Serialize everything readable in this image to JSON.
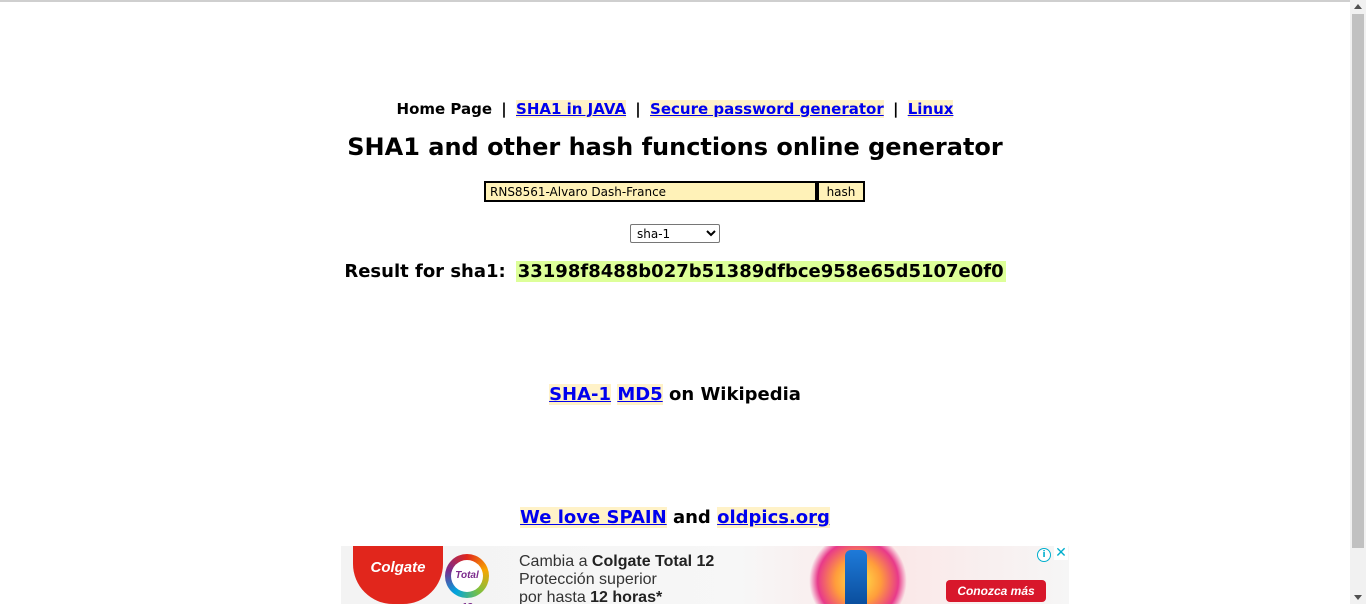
{
  "nav": {
    "home": "Home Page",
    "separator": "|",
    "links": [
      "SHA1 in JAVA",
      "Secure password generator",
      "Linux"
    ]
  },
  "title": "SHA1 and other hash functions online generator",
  "form": {
    "input_value": "RNS8561-Alvaro Dash-France",
    "button_label": "hash",
    "algorithm_selected": "sha-1"
  },
  "result": {
    "label": "Result for sha1:",
    "value": "33198f8488b027b51389dfbce958e65d5107e0f0"
  },
  "wiki_links": {
    "link1": "SHA-1",
    "link2": "MD5",
    "suffix": "on Wikipedia"
  },
  "footer_links": {
    "link1": "We love SPAIN",
    "conjunction": "and",
    "link2": "oldpics.org"
  },
  "ad": {
    "logo_text": "Colgate",
    "total_text": "Total 12",
    "line1_prefix": "Cambia a ",
    "line1_bold": "Colgate Total 12",
    "line2": "Protección superior",
    "line3_prefix": "por hasta ",
    "line3_bold": "12 horas*",
    "cta": "Conozca más",
    "info_icon": "i",
    "close_icon": "✕"
  },
  "colors": {
    "link": "#0000ee",
    "link_highlight": "#fff2c8",
    "input_bg": "#fff2b8",
    "result_highlight": "#ddff99",
    "ad_brand": "#e1261c"
  }
}
